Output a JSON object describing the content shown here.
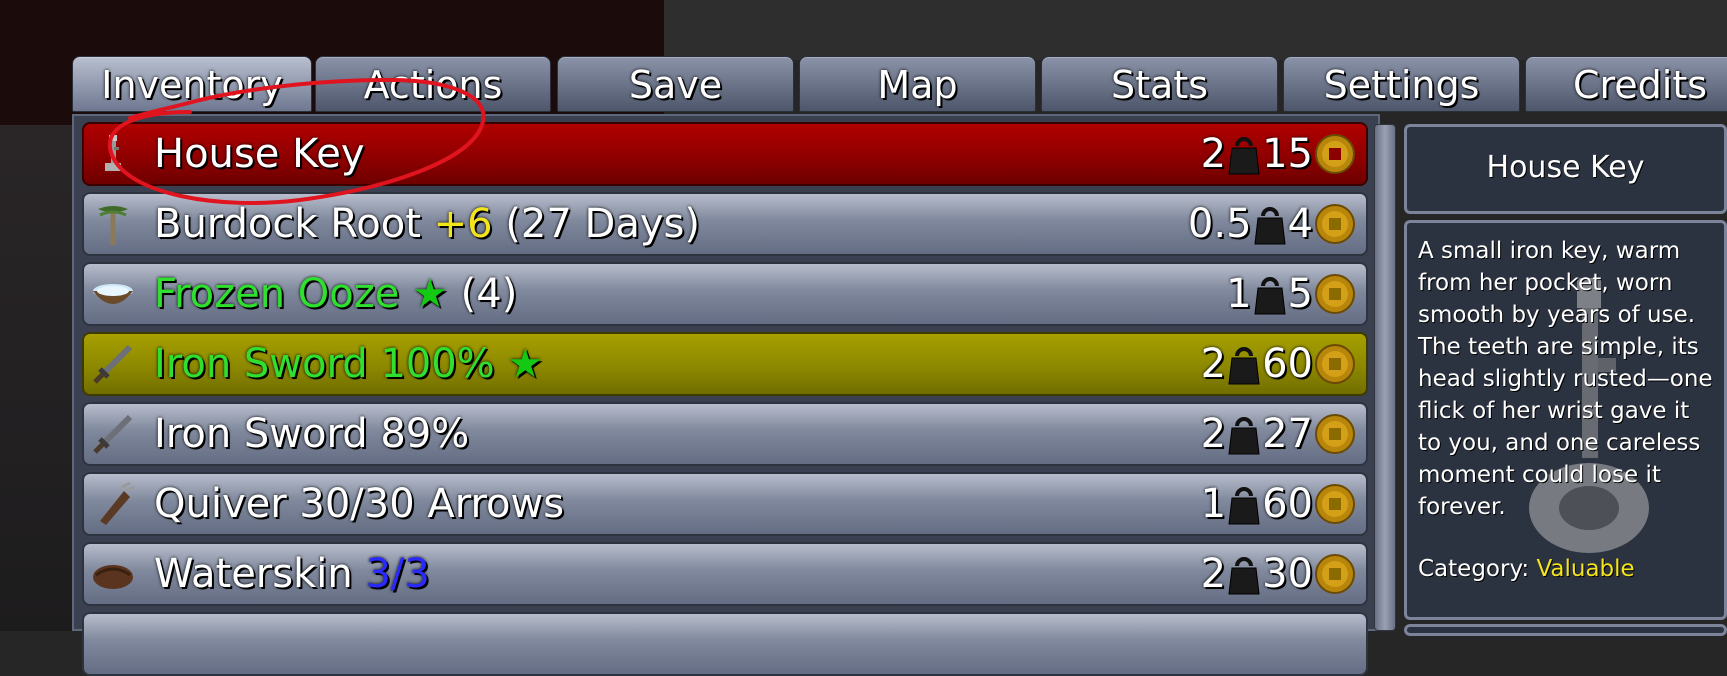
{
  "tabs": [
    {
      "label": "Inventory",
      "active": true
    },
    {
      "label": "Actions"
    },
    {
      "label": "Save"
    },
    {
      "label": "Map"
    },
    {
      "label": "Stats"
    },
    {
      "label": "Settings"
    },
    {
      "label": "Credits"
    }
  ],
  "items": [
    {
      "name": "House Key",
      "weight": "2",
      "value": "15",
      "icon": "key-icon",
      "highlight": "red"
    },
    {
      "name": "Burdock Root",
      "bonus": "+6",
      "extra": "(27 Days)",
      "weight": "0.5",
      "value": "4",
      "icon": "root-icon"
    },
    {
      "name": "Frozen Ooze",
      "star": "★",
      "extra": "(4)",
      "weight": "1",
      "value": "5",
      "icon": "ooze-bowl-icon"
    },
    {
      "name": "Iron Sword 100%",
      "star": "★",
      "weight": "2",
      "value": "60",
      "icon": "sword-icon",
      "highlight": "yellow"
    },
    {
      "name": "Iron Sword 89%",
      "weight": "2",
      "value": "27",
      "icon": "sword-icon"
    },
    {
      "name": "Quiver 30/30 Arrows",
      "weight": "1",
      "value": "60",
      "icon": "quiver-icon"
    },
    {
      "name": "Waterskin",
      "charges": "3/3",
      "weight": "2",
      "value": "30",
      "icon": "waterskin-icon"
    }
  ],
  "details": {
    "title": "House Key",
    "description": "A small iron key, warm from her pocket, worn smooth by years of use. The teeth are simple, its head slightly rusted—one flick of her wrist gave it to you, and one careless moment could lose it forever.",
    "category_label": "Category:",
    "category_value": "Valuable"
  },
  "colors": {
    "selected_red": "#a00000",
    "selected_yellow": "#979200",
    "name_green": "#2fe02f",
    "bonus_yellow": "#f4e41a",
    "charges_blue": "#2a2aff",
    "annotation_red": "#e0141e"
  }
}
